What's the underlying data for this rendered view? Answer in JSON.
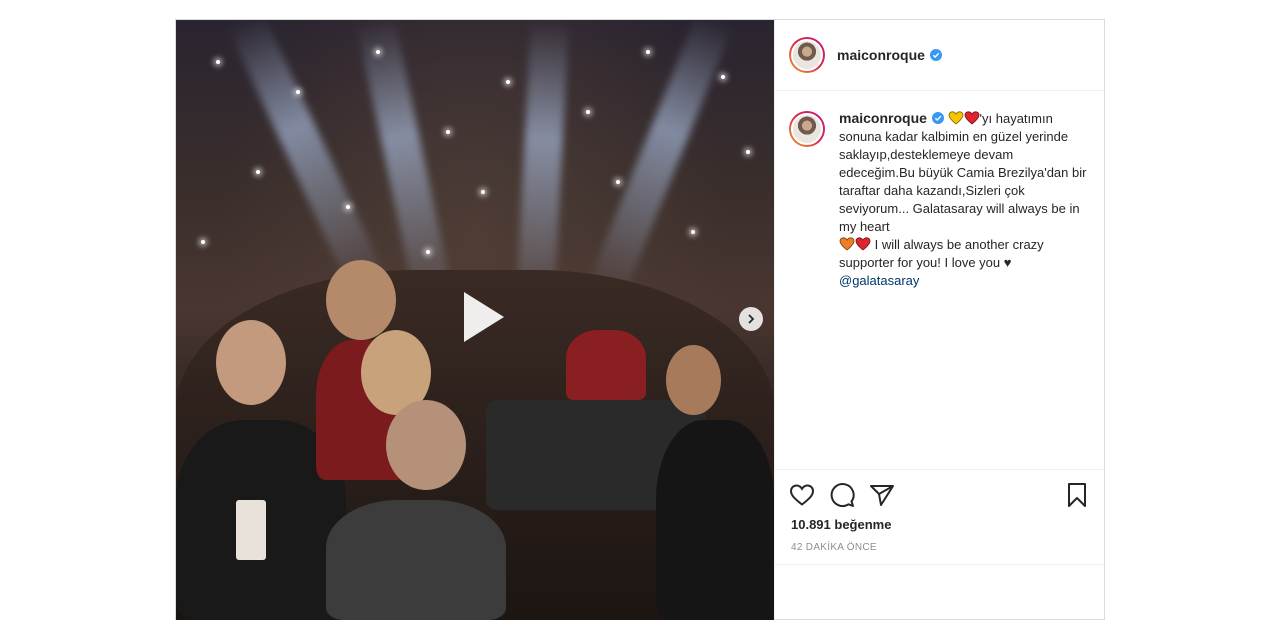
{
  "post": {
    "username": "maiconroque",
    "verified": true,
    "caption_part1": "'yı hayatımın sonuna kadar kalbimin en güzel yerinde saklayıp,desteklemeye devam edeceğim.Bu büyük Camia Brezilya'dan bir taraftar daha kazandı,Sizleri çok seviyorum... Galatasaray will always be in my heart",
    "caption_part2": " I will always be another crazy supporter for you! I love you ♥",
    "mention": "@galatasaray",
    "likes": "10.891 beğenme",
    "timestamp": "42 DAKİKA ÖNCE"
  },
  "icons": {
    "play": "play-icon",
    "next": "chevron-right-icon",
    "like": "heart-outline-icon",
    "comment": "comment-icon",
    "share": "paper-plane-icon",
    "save": "bookmark-icon",
    "verified": "verified-badge-icon"
  },
  "colors": {
    "verified_blue": "#3897f0",
    "heart_yellow": "#f5c400",
    "heart_red": "#e0242f",
    "heart_orange": "#ef7d23",
    "link": "#00376b",
    "muted": "#8e8e8e"
  }
}
